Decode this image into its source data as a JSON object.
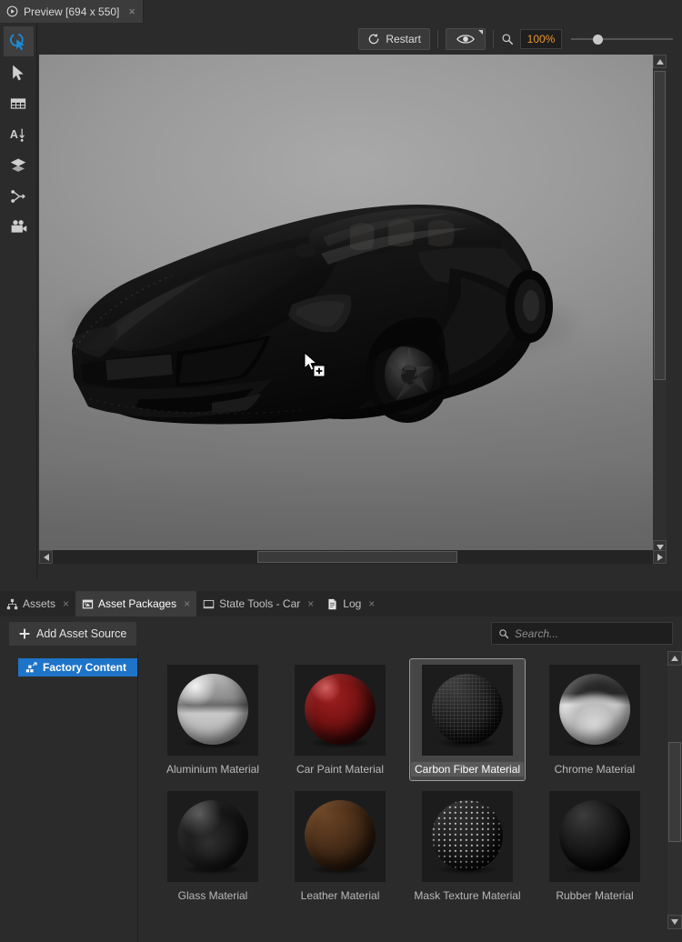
{
  "window": {
    "top_tab": {
      "label": "Preview [694 x 550]",
      "icon": "play-circle-icon",
      "close": "×"
    }
  },
  "left_rail": {
    "items": [
      {
        "name": "interact-tool",
        "icon": "cursor-interact-icon",
        "active": true
      },
      {
        "name": "select-tool",
        "icon": "arrow-pointer-icon",
        "active": false
      },
      {
        "name": "table-tool",
        "icon": "grid-table-icon",
        "active": false
      },
      {
        "name": "text-tool",
        "icon": "text-animate-icon",
        "active": false
      },
      {
        "name": "layers-tool",
        "icon": "layers-icon",
        "active": false
      },
      {
        "name": "branch-tool",
        "icon": "branch-merge-icon",
        "active": false
      },
      {
        "name": "camera-tool",
        "icon": "movie-camera-icon",
        "active": false
      }
    ]
  },
  "preview_toolbar": {
    "restart_label": "Restart",
    "restart_icon": "refresh-icon",
    "eye_icon": "eye-icon",
    "zoom_icon": "magnifier-icon",
    "zoom_value": "100%",
    "slider_position_pct": 25,
    "accent_color": "#e8962e"
  },
  "viewport": {
    "content": "3d-car-render",
    "cursor": "drag-copy-cursor"
  },
  "bottom_panel": {
    "tabs": [
      {
        "label": "Assets",
        "icon": "assets-icon",
        "active": false,
        "close": "×"
      },
      {
        "label": "Asset Packages",
        "icon": "package-icon",
        "active": true,
        "close": "×"
      },
      {
        "label": "State Tools - Car",
        "icon": "state-tools-icon",
        "active": false,
        "close": "×"
      },
      {
        "label": "Log",
        "icon": "log-document-icon",
        "active": false,
        "close": "×"
      }
    ],
    "add_asset_source": {
      "label": "Add Asset Source",
      "icon": "plus-icon"
    },
    "search": {
      "placeholder": "Search...",
      "value": "",
      "icon": "search-icon"
    },
    "tree": {
      "items": [
        {
          "label": "Factory Content",
          "icon": "factory-content-icon",
          "selected": true
        }
      ],
      "selection_color": "#1e74c8"
    },
    "assets": [
      {
        "label": "Aluminium Material",
        "selected": false,
        "swatch": "aluminium"
      },
      {
        "label": "Car Paint Material",
        "selected": false,
        "swatch": "car-paint"
      },
      {
        "label": "Carbon Fiber Material",
        "selected": true,
        "swatch": "carbon-fiber"
      },
      {
        "label": "Chrome Material",
        "selected": false,
        "swatch": "chrome"
      },
      {
        "label": "Glass Material",
        "selected": false,
        "swatch": "glass"
      },
      {
        "label": "Leather Material",
        "selected": false,
        "swatch": "leather"
      },
      {
        "label": "Mask Texture Material",
        "selected": false,
        "swatch": "mask-texture"
      },
      {
        "label": "Rubber Material",
        "selected": false,
        "swatch": "rubber"
      }
    ]
  }
}
